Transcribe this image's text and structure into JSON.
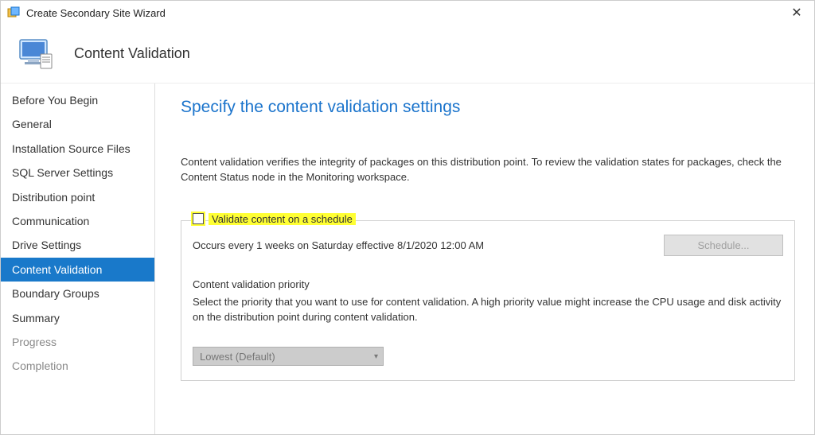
{
  "titlebar": {
    "title": "Create Secondary Site Wizard",
    "close_glyph": "✕"
  },
  "header": {
    "heading": "Content Validation"
  },
  "sidebar": {
    "items": [
      {
        "label": "Before You Begin",
        "state": "normal"
      },
      {
        "label": "General",
        "state": "normal"
      },
      {
        "label": "Installation Source Files",
        "state": "normal"
      },
      {
        "label": "SQL Server Settings",
        "state": "normal"
      },
      {
        "label": "Distribution point",
        "state": "normal"
      },
      {
        "label": "Communication",
        "state": "normal"
      },
      {
        "label": "Drive Settings",
        "state": "normal"
      },
      {
        "label": "Content Validation",
        "state": "selected"
      },
      {
        "label": "Boundary Groups",
        "state": "normal"
      },
      {
        "label": "Summary",
        "state": "normal"
      },
      {
        "label": "Progress",
        "state": "disabled"
      },
      {
        "label": "Completion",
        "state": "disabled"
      }
    ]
  },
  "page": {
    "title": "Specify the content validation settings",
    "description": "Content validation verifies the integrity of packages on this distribution point. To review the validation states for packages, check the Content Status node in the Monitoring workspace.",
    "checkbox_label": "Validate content on a schedule",
    "checkbox_checked": false,
    "schedule_text": "Occurs every 1 weeks on Saturday effective 8/1/2020 12:00 AM",
    "schedule_button": "Schedule...",
    "priority_heading": "Content validation priority",
    "priority_desc": "Select the priority that you want to use for content validation. A high priority value might increase the CPU usage and disk activity on the distribution point during content validation.",
    "priority_value": "Lowest (Default)"
  }
}
